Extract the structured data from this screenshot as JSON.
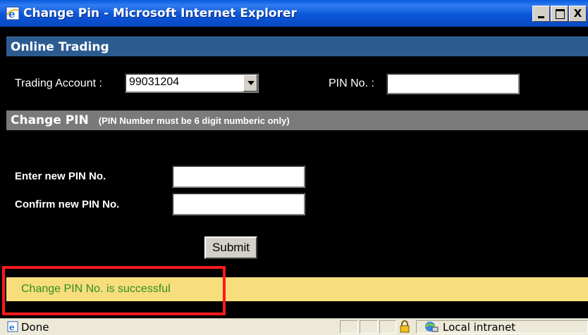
{
  "window": {
    "title": "Change Pin - Microsoft Internet Explorer",
    "minimize_icon": "minimize-icon",
    "maximize_icon": "maximize-icon",
    "close_label": "X"
  },
  "sections": {
    "online_trading": "Online Trading",
    "change_pin": "Change PIN",
    "change_pin_note": "(PIN Number must be 6 digit numberic only)"
  },
  "form": {
    "trading_account_label": "Trading Account :",
    "trading_account_value": "99031204",
    "pin_label": "PIN No. :",
    "pin_value": "",
    "new_pin_label": "Enter new PIN No.",
    "new_pin_value": "",
    "confirm_pin_label": "Confirm new PIN No.",
    "confirm_pin_value": "",
    "submit_label": "Submit"
  },
  "message": {
    "text": "Change PIN No. is successful",
    "color": "#2f8f1e",
    "background": "#f7dd7c",
    "highlight_color": "#ff1a1a"
  },
  "statusbar": {
    "status": "Done",
    "zone": "Local intranet",
    "icons": [
      "ie-page-icon",
      "lock-icon",
      "intranet-icon"
    ]
  },
  "colors": {
    "titlebar": "#0b55d9",
    "section_bar_blue": "#2c5b90",
    "section_bar_gray": "#7a7a7a",
    "background": "#000000"
  }
}
